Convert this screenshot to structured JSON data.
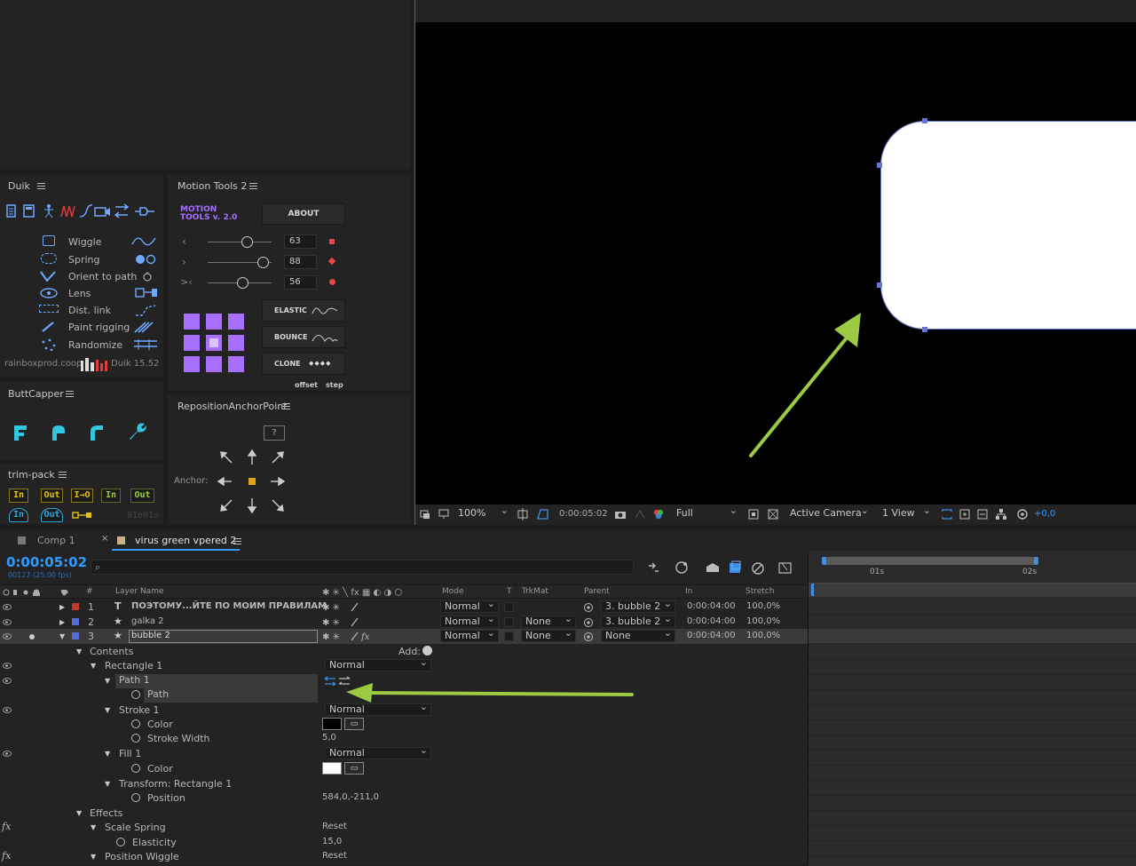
{
  "panels": {
    "duik": {
      "title": "Duik",
      "items": [
        "Wiggle",
        "Spring",
        "Orient to path",
        "Lens",
        "Dist. link",
        "Paint rigging",
        "Randomize"
      ],
      "footer_left": "rainboxprod.coop",
      "footer_right": "Duik 15.52"
    },
    "motion_tools": {
      "title": "Motion Tools 2",
      "logo_line1": "MOTION",
      "logo_line2": "TOOLS v. 2.0",
      "about": "ABOUT",
      "sliders": [
        {
          "symbol": "‹",
          "value": "63",
          "fill": 0.5
        },
        {
          "symbol": "›",
          "value": "88",
          "fill": 0.85
        },
        {
          "symbol": ">‹",
          "value": "56",
          "fill": 0.45
        }
      ],
      "elastic": "ELASTIC",
      "bounce": "BOUNCE",
      "clone": "CLONE",
      "clone_dots": "◆◆◆◆",
      "offset": "offset",
      "step": "step"
    },
    "buttcapper": {
      "title": "ButtCapper"
    },
    "trimpack": {
      "title": "trim-pack",
      "row1": [
        "In",
        "Out",
        "I→O",
        "In",
        "Out"
      ],
      "row2": [
        "In",
        "Out",
        "",
        "",
        ""
      ],
      "code": "01o01o"
    },
    "reposition": {
      "title": "RepositionAnchorPoint",
      "help": "?",
      "anchor_label": "Anchor:"
    }
  },
  "viewer": {
    "zoom": "100%",
    "timecode": "0:00:05:02",
    "resolution": "Full",
    "camera": "Active Camera",
    "views": "1 View",
    "exposure": "+0,0"
  },
  "tabs": [
    {
      "label": "Comp 1",
      "active": false
    },
    {
      "label": "virus green vpered 2",
      "active": true
    }
  ],
  "timeline": {
    "time": "0:00:05:02",
    "frames": "00127 (25.00 fps)",
    "search_placeholder": "",
    "columns": {
      "hash": "#",
      "layer_name": "Layer Name",
      "mode": "Mode",
      "t": "T",
      "trkmat": "TrkMat",
      "parent": "Parent",
      "in": "In",
      "stretch": "Stretch"
    },
    "ruler": {
      "t1": "01s",
      "t2": "02s"
    },
    "layers": [
      {
        "num": "1",
        "icon": "T",
        "name": "ПОЭТОМУ...ЙТЕ ПО МОИМ ПРАВИЛАМ",
        "color": "#c0392b",
        "mode": "Normal",
        "trkmat": "",
        "parent": "3. bubble 2",
        "in": "0:00:04:00",
        "stretch": "100,0%"
      },
      {
        "num": "2",
        "icon": "★",
        "name": "galka 2",
        "color": "#5a6bd6",
        "mode": "Normal",
        "trkmat": "None",
        "parent": "3. bubble 2",
        "in": "0:00:04:00",
        "stretch": "100,0%"
      },
      {
        "num": "3",
        "icon": "★",
        "name": "bubble 2",
        "color": "#5a6bd6",
        "mode": "Normal",
        "trkmat": "None",
        "parent": "None",
        "in": "0:00:04:00",
        "stretch": "100,0%"
      }
    ],
    "props": {
      "contents": "Contents",
      "add": "Add:",
      "rectangle": "Rectangle 1",
      "rect_mode": "Normal",
      "path1": "Path 1",
      "path": "Path",
      "stroke": "Stroke 1",
      "stroke_mode": "Normal",
      "color": "Color",
      "stroke_width": "Stroke Width",
      "stroke_width_val": "5,0",
      "fill": "Fill 1",
      "fill_mode": "Normal",
      "fill_color": "Color",
      "transform": "Transform: Rectangle 1",
      "position": "Position",
      "position_val": "584,0,-211,0",
      "effects": "Effects",
      "scale_spring": "Scale Spring",
      "reset": "Reset",
      "elasticity": "Elasticity",
      "elasticity_val": "15,0",
      "position_wiggle": "Position Wiggle",
      "reset2": "Reset"
    }
  },
  "colors": {
    "accent": "#2f9bff",
    "arrow": "#9ccb43",
    "motion_purple": "#a770ff",
    "trim_yellow": "#e4c21c",
    "buttcap_cyan": "#33c6e0"
  }
}
